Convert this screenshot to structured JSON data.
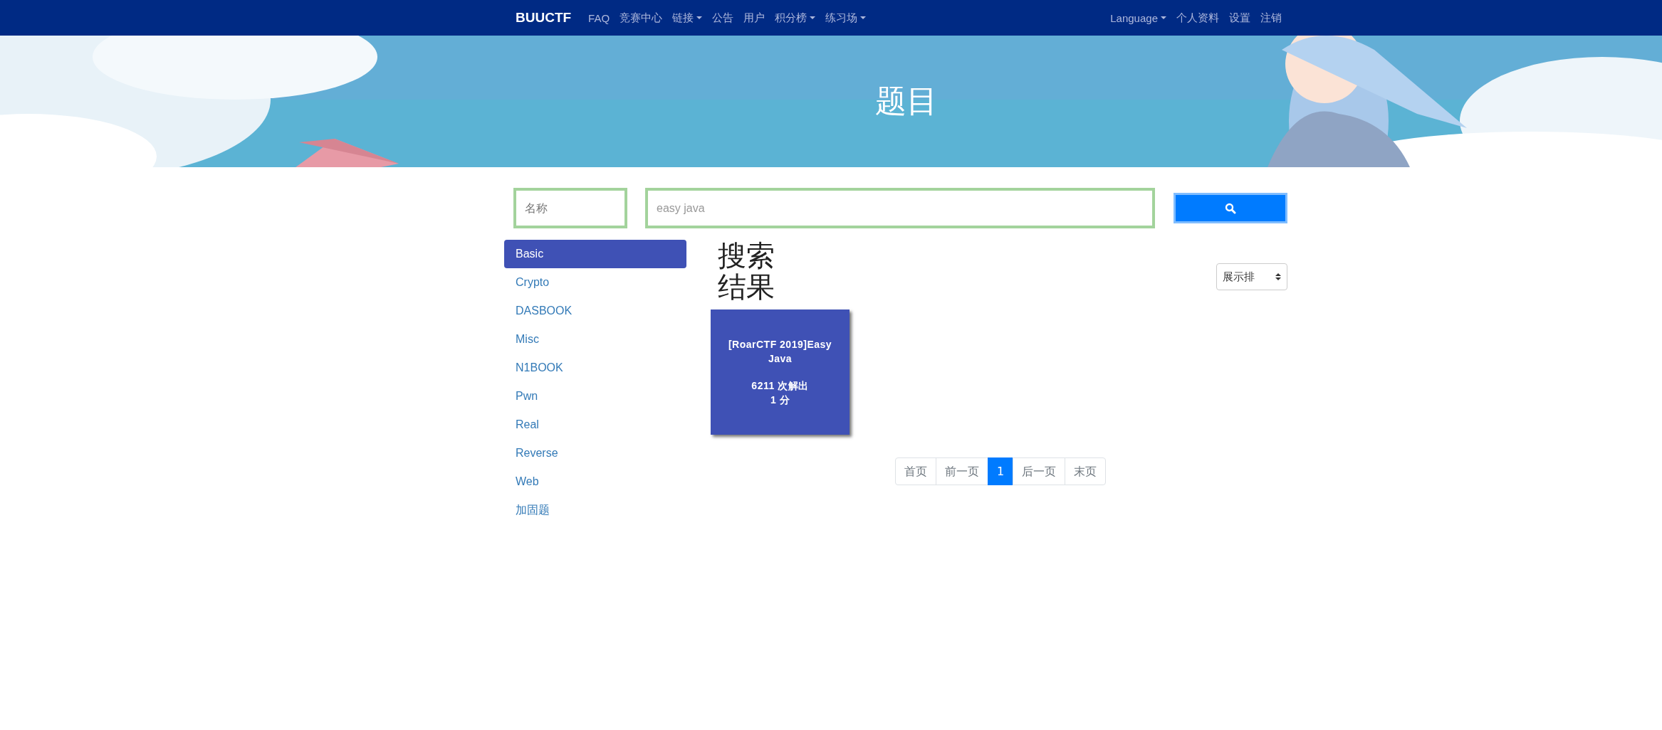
{
  "navbar": {
    "brand": "BUUCTF",
    "left_items": [
      {
        "label": "FAQ",
        "dropdown": false
      },
      {
        "label": "竞赛中心",
        "dropdown": false
      },
      {
        "label": "链接",
        "dropdown": true
      },
      {
        "label": "公告",
        "dropdown": false
      },
      {
        "label": "用户",
        "dropdown": false
      },
      {
        "label": "积分榜",
        "dropdown": true
      },
      {
        "label": "练习场",
        "dropdown": true
      }
    ],
    "right_items": [
      {
        "label": "Language",
        "dropdown": true
      },
      {
        "label": "个人资料",
        "dropdown": false
      },
      {
        "label": "设置",
        "dropdown": false
      },
      {
        "label": "注销",
        "dropdown": false
      }
    ]
  },
  "banner": {
    "title": "题目",
    "kind": "picture"
  },
  "search": {
    "name_placeholder": "名称",
    "query": "easy java"
  },
  "categories": [
    {
      "label": "Basic",
      "selected": true
    },
    {
      "label": "Crypto",
      "selected": false
    },
    {
      "label": "DASBOOK",
      "selected": false
    },
    {
      "label": "Misc",
      "selected": false
    },
    {
      "label": "N1BOOK",
      "selected": false
    },
    {
      "label": "Pwn",
      "selected": false
    },
    {
      "label": "Real",
      "selected": false
    },
    {
      "label": "Reverse",
      "selected": false
    },
    {
      "label": "Web",
      "selected": false
    },
    {
      "label": "加固题",
      "selected": false
    }
  ],
  "results": {
    "heading": "搜索结果",
    "sort_label": "展示排",
    "challenges": [
      {
        "name": "[RoarCTF 2019]Easy Java",
        "solves": "6211 次解出",
        "points": "1 分"
      }
    ]
  },
  "pagination": [
    {
      "label": "首页",
      "selected": false
    },
    {
      "label": "前一页",
      "selected": false
    },
    {
      "label": "1",
      "selected": true
    },
    {
      "label": "后一页",
      "selected": false
    },
    {
      "label": "末页",
      "selected": false
    }
  ]
}
